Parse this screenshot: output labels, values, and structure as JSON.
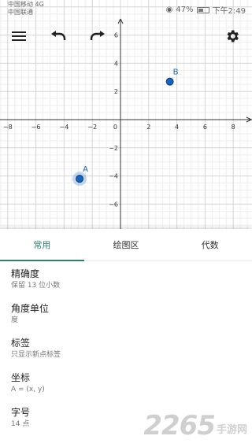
{
  "status_bar": {
    "carrier_line1": "中国移动 4G",
    "carrier_line2": "中国联通",
    "battery": "47%",
    "time": "下午2:49"
  },
  "toolbar": {
    "menu_icon": "hamburger-menu-icon",
    "undo_icon": "undo-icon",
    "redo_icon": "redo-icon",
    "settings_icon": "gear-icon"
  },
  "graph": {
    "x_ticks": [
      "−8",
      "−6",
      "−4",
      "−2",
      "0",
      "2",
      "4",
      "6",
      "8"
    ],
    "y_ticks": [
      "6",
      "4",
      "2",
      "−2",
      "−4",
      "−6"
    ],
    "points": [
      {
        "label": "A",
        "x": -2.9,
        "y": -4.2,
        "selected": true
      },
      {
        "label": "B",
        "x": 3.5,
        "y": 2.7,
        "selected": false
      }
    ],
    "point_color": "#1565c0",
    "grid": true
  },
  "tabs": [
    {
      "label": "常用",
      "active": true
    },
    {
      "label": "绘图区",
      "active": false
    },
    {
      "label": "代数",
      "active": false
    }
  ],
  "accent_color": "#2d7f6f",
  "settings": [
    {
      "title": "精确度",
      "value": "保留 13 位小数"
    },
    {
      "title": "角度单位",
      "value": "度"
    },
    {
      "title": "标签",
      "value": "只显示新点标签"
    },
    {
      "title": "坐标",
      "value": "A = (x, y)"
    },
    {
      "title": "字号",
      "value": "14 点"
    }
  ],
  "watermark": {
    "number": "2265",
    "text": "手游网"
  }
}
